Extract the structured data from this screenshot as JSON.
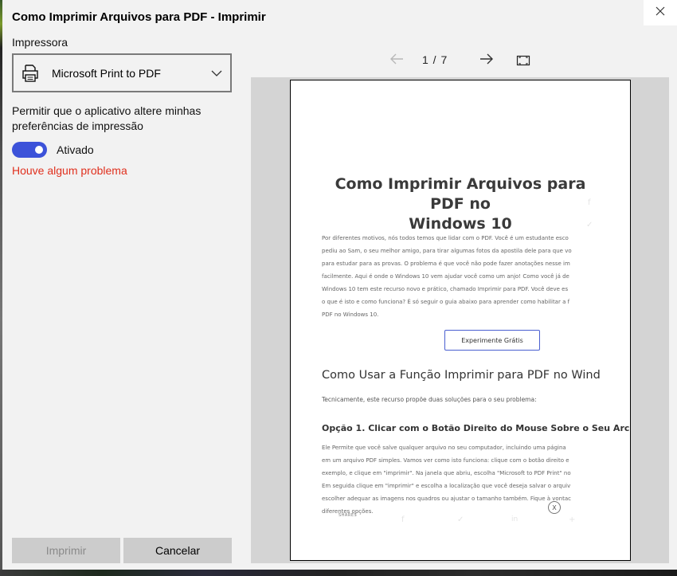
{
  "dialog": {
    "title": "Como Imprimir Arquivos para PDF - Imprimir",
    "printer_label": "Impressora",
    "printer_name": "Microsoft Print to PDF",
    "permission_text": "Permitir que o aplicativo altere minhas preferências de impressão",
    "toggle_label": "Ativado",
    "toggle_on": true,
    "error_link": "Houve algum problema",
    "print_button": "Imprimir",
    "cancel_button": "Cancelar",
    "accent_color": "#3c52d9",
    "error_color": "#e0301e"
  },
  "preview": {
    "page_counter": "1 / 7",
    "document": {
      "title_line1": "Como Imprimir Arquivos para PDF no",
      "title_line2": "Windows 10",
      "paragraph_lines": [
        "Por diferentes motivos, nós todos temos que lidar com o PDF. Você é um estudante esco",
        "pediu ao Sam, o seu melhor amigo, para tirar algumas fotos da apostila dele para que vo",
        "para estudar para as provas. O problema é que você não pode fazer anotações nesse im",
        "facilmente. Aqui é onde o Windows 10 vem ajudar você como um anjo! Como você já de",
        "Windows 10 tem este recurso novo e prático, chamado Imprimir para PDF. Você deve es",
        "o que é isto e como funciona? É só seguir o guia abaixo para aprender como habilitar a f",
        "PDF no Windows 10."
      ],
      "cta_button": "Experimente Grátis",
      "section_heading": "Como Usar a Função Imprimir para PDF no Wind",
      "section_intro": "Tecnicamente, este recurso propõe duas soluções para o seu problema:",
      "option_heading": "Opção 1. Clicar com o Botão Direito do Mouse Sobre o Seu Arc",
      "option_lines": [
        "Ele Permite que você salve qualquer arquivo no seu computador, incluindo uma página",
        "em um arquivo PDF simples. Vamos ver como isto funciona: clique com o botão direito e",
        "exemplo, e clique em \"imprimir\". Na janela que abriu, escolha \"Microsoft to PDF Print\" no",
        "Em seguida clique em \"imprimir\" e escolha a localização que você deseja salvar o arquiv",
        "escolher adequar as imagens nos quadros ou ajustar o tamanho também. Fique à vontac",
        "diferentes opções."
      ],
      "shares_label": "SHARES",
      "close_glyph": "X"
    }
  }
}
